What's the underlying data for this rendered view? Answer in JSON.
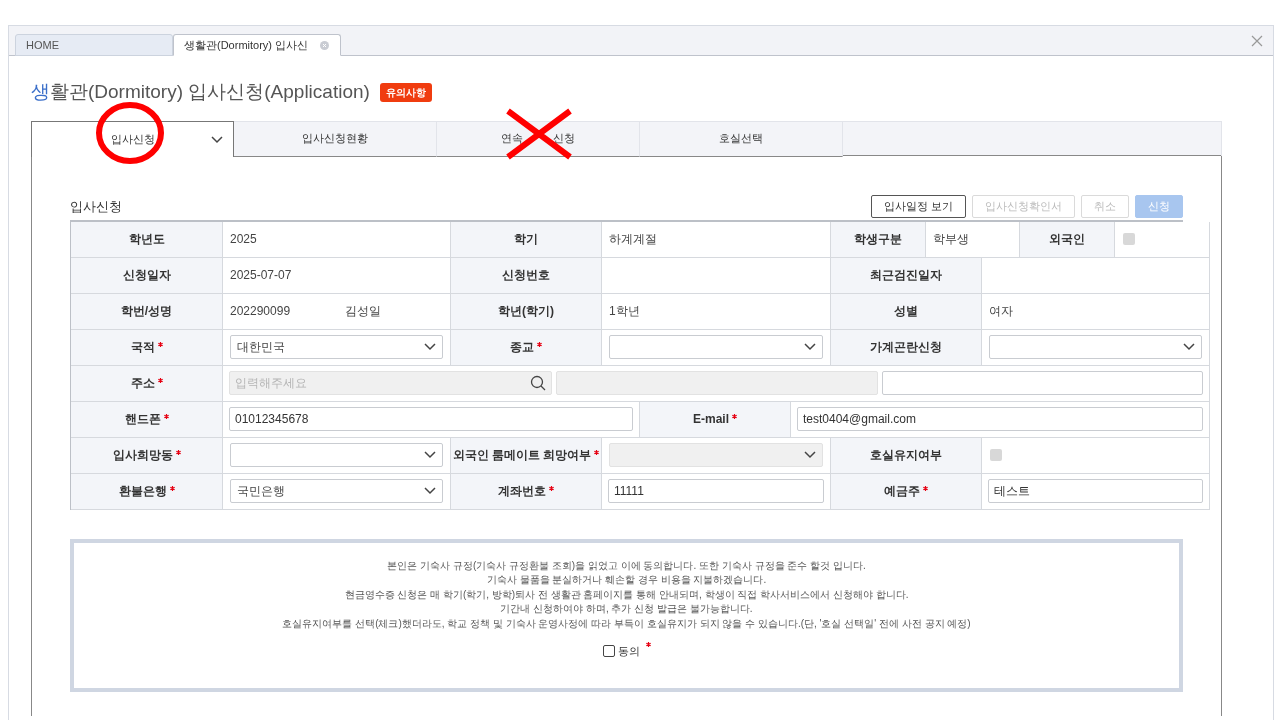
{
  "window_tabs": [
    {
      "label": "HOME",
      "selected": false,
      "closable": false
    },
    {
      "label": "생활관(Dormitory) 입사신",
      "selected": true,
      "closable": true
    }
  ],
  "page_title": {
    "first_letter": "생",
    "rest": "활관(Dormitory) 입사신청(Application)"
  },
  "notice_badge": "유의사항",
  "tabs": [
    {
      "label_parts": [
        "입사신청"
      ],
      "selected": true,
      "dropdown": true
    },
    {
      "label_parts": [
        "입사신청현황"
      ],
      "selected": false,
      "dropdown": false
    },
    {
      "label_parts": [
        "연속",
        "신청"
      ],
      "selected": false,
      "dropdown": false
    },
    {
      "label_parts": [
        "호실선택"
      ],
      "selected": false,
      "dropdown": false
    }
  ],
  "annotations": [
    {
      "kind": "circle"
    },
    {
      "kind": "cross"
    }
  ],
  "section_title": "입사신청",
  "buttons": [
    {
      "label": "입사일정 보기",
      "kind": "outline",
      "disabled": false
    },
    {
      "label": "입사신청확인서",
      "kind": "outline",
      "disabled": true
    },
    {
      "label": "취소",
      "kind": "outline",
      "disabled": true
    },
    {
      "label": "신청",
      "kind": "primary",
      "disabled": true
    }
  ],
  "form_rows": [
    {
      "cells": [
        {
          "kind": "label",
          "text": "학년도",
          "required": false
        },
        {
          "kind": "text",
          "text": "2025"
        },
        {
          "kind": "label",
          "text": "학기",
          "required": false
        },
        {
          "kind": "text",
          "text": "하계계절"
        },
        {
          "kind": "label",
          "text": "학생구분",
          "required": false
        },
        {
          "kind": "text",
          "text": "학부생"
        },
        {
          "kind": "label",
          "text": "외국인",
          "required": false
        },
        {
          "kind": "checkbox",
          "checked": false,
          "disabled": true
        }
      ]
    },
    {
      "cells": [
        {
          "kind": "label",
          "text": "신청일자",
          "required": false
        },
        {
          "kind": "text",
          "text": "2025-07-07"
        },
        {
          "kind": "label",
          "text": "신청번호",
          "required": false
        },
        {
          "kind": "empty"
        },
        {
          "kind": "label",
          "text": "최근검진일자",
          "required": false
        },
        {
          "kind": "empty"
        }
      ]
    },
    {
      "cells": [
        {
          "kind": "label",
          "text": "학번/성명",
          "required": false
        },
        {
          "kind": "pair",
          "texts": [
            "202290099",
            "김성일"
          ]
        },
        {
          "kind": "label",
          "text": "학년(학기)",
          "required": false
        },
        {
          "kind": "text",
          "text": "1학년"
        },
        {
          "kind": "label",
          "text": "성별",
          "required": false
        },
        {
          "kind": "text",
          "text": "여자"
        }
      ]
    },
    {
      "cells": [
        {
          "kind": "label",
          "text": "국적",
          "required": true
        },
        {
          "kind": "select",
          "value": "대한민국",
          "disabled": false
        },
        {
          "kind": "label",
          "text": "종교",
          "required": true
        },
        {
          "kind": "select",
          "disabled": false
        },
        {
          "kind": "label",
          "text": "가계곤란신청",
          "required": false
        },
        {
          "kind": "select",
          "disabled": false
        }
      ]
    },
    {
      "cells": [
        {
          "kind": "label",
          "text": "주소",
          "required": true
        },
        {
          "kind": "address",
          "placeholder": "입력해주세요"
        }
      ]
    },
    {
      "cells": [
        {
          "kind": "label",
          "text": "핸드폰",
          "required": true
        },
        {
          "kind": "input",
          "value": "01012345678"
        },
        {
          "kind": "label",
          "text": "E-mail",
          "required": true
        },
        {
          "kind": "input",
          "value": "test0404@gmail.com"
        }
      ]
    },
    {
      "cells": [
        {
          "kind": "label",
          "text": "입사희망동",
          "required": true
        },
        {
          "kind": "select",
          "disabled": false
        },
        {
          "kind": "label",
          "text": "외국인 룸메이트 희망여부",
          "required": true
        },
        {
          "kind": "select",
          "disabled": true
        },
        {
          "kind": "label",
          "text": "호실유지여부",
          "required": false
        },
        {
          "kind": "checkbox",
          "checked": false,
          "disabled": true
        }
      ]
    },
    {
      "cells": [
        {
          "kind": "label",
          "text": "환불은행",
          "required": true
        },
        {
          "kind": "select",
          "value": "국민은행",
          "disabled": false
        },
        {
          "kind": "label",
          "text": "계좌번호",
          "required": true
        },
        {
          "kind": "input",
          "value": "11111"
        },
        {
          "kind": "label",
          "text": "예금주",
          "required": true
        },
        {
          "kind": "input",
          "value": "테스트"
        }
      ]
    }
  ],
  "agreement": {
    "lines": [
      "본인은 기숙사 규정(기숙사 규정환불 조회)을 읽었고 이에 동의합니다. 또한 기숙사 규정을 준수 할것 입니다.",
      "기숙사 물품을 분실하거나 훼손할 경우 비용을 지불하겠습니다.",
      "현금영수증 신청은 매 학기(학기, 방학)퇴사 전 생활관 홈페이지를 통해 안내되며, 학생이 직접 학사서비스에서 신청해야 합니다.",
      "기간내 신청하여야 하며, 추가 신청 발급은 불가능합니다.",
      "호실유지여부를 선택(체크)했더라도, 학교 정책 및 기숙사 운영사정에 따라 부득이 호실유지가 되지 않을 수 있습니다.(단, '호실 선택일' 전에 사전 공지 예정)"
    ],
    "checkbox": {
      "label": "동의",
      "checked": false,
      "required": true
    }
  }
}
